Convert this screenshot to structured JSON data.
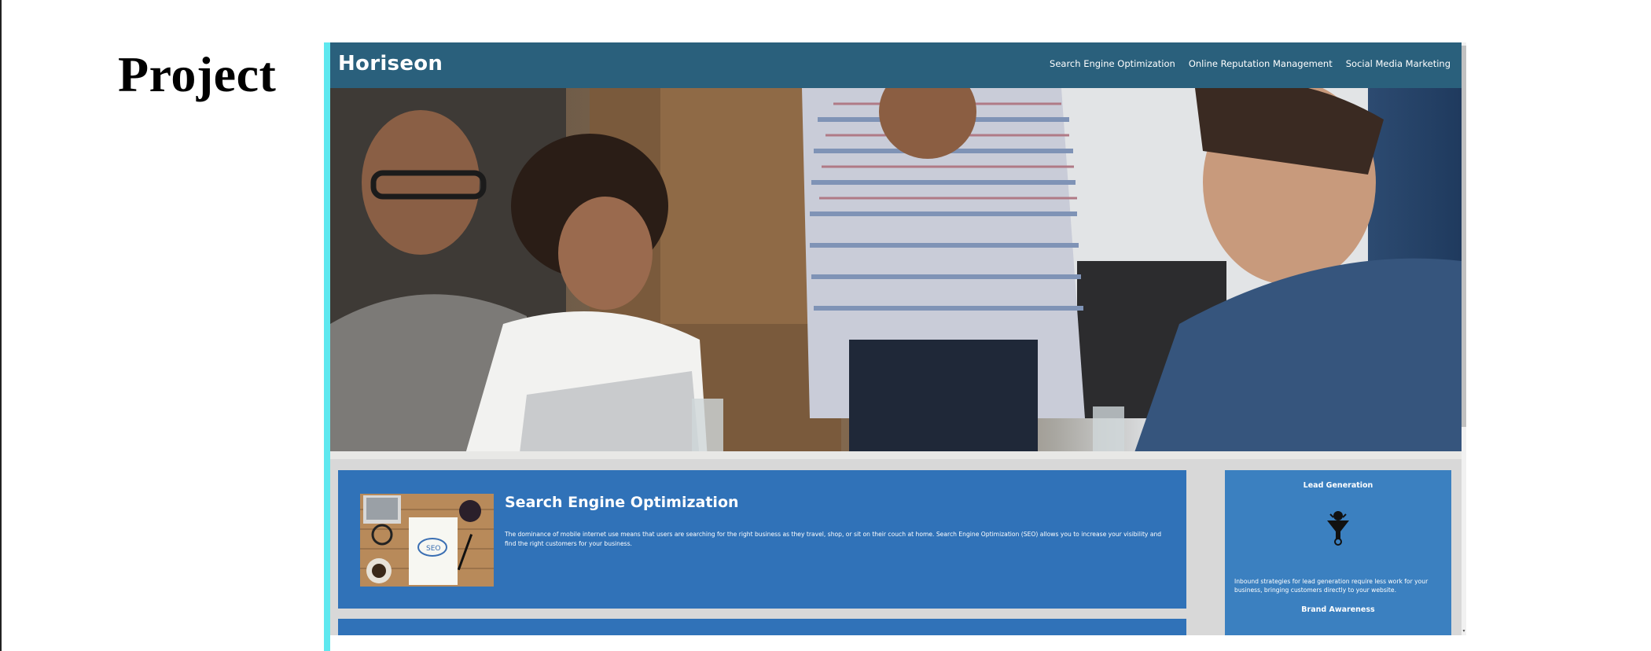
{
  "page": {
    "heading": "Project"
  },
  "site": {
    "logo": "Horiseon",
    "nav": [
      {
        "label": "Search Engine Optimization"
      },
      {
        "label": "Online Reputation Management"
      },
      {
        "label": "Social Media Marketing"
      }
    ]
  },
  "content": {
    "seo": {
      "title": "Search Engine Optimization",
      "text": "The dominance of mobile internet use means that users are searching for the right business as they travel, shop, or sit on their couch at home. Search Engine Optimization (SEO) allows you to increase your visibility and find the right customers for your business.",
      "image_icon": "seo-notebook-image"
    }
  },
  "aside": {
    "lead_title": "Lead Generation",
    "lead_icon": "lead-generation-funnel-icon",
    "lead_text": "Inbound strategies for lead generation require less work for your business, bringing customers directly to your website.",
    "brand_title": "Brand Awareness"
  },
  "colors": {
    "header": "#2a607c",
    "card": "#3072b8",
    "aside": "#3b80c0",
    "accent_bar": "#5ee8ef"
  }
}
